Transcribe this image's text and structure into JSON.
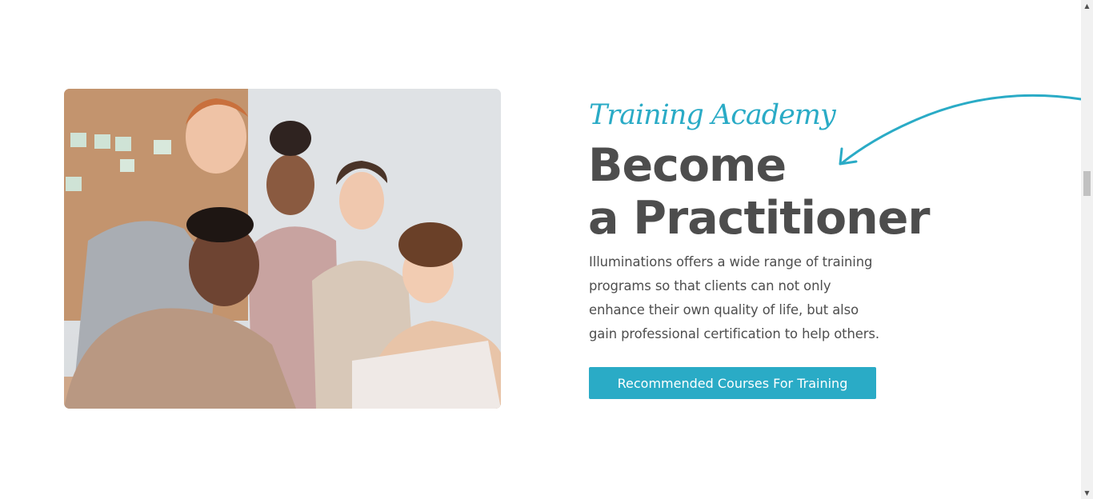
{
  "section": {
    "eyebrow": "Training Academy",
    "headline_line1": "Become",
    "headline_line2": "a Practitioner",
    "description_lines": [
      "Illuminations offers a wide range of training",
      "programs so that clients can not only",
      "enhance their own quality of life, but also",
      "gain professional certification to help others."
    ],
    "cta_label": "Recommended Courses For Training"
  },
  "colors": {
    "accent": "#2aabc6",
    "heading": "#4d4d4d",
    "body_text": "#4e4e4e"
  },
  "icons": {
    "arrow": "curved-arrow-icon",
    "scroll_up": "scroll-up-arrow-icon",
    "scroll_down": "scroll-down-arrow-icon"
  },
  "scrollbar": {
    "up_glyph": "▲",
    "down_glyph": "▼"
  }
}
